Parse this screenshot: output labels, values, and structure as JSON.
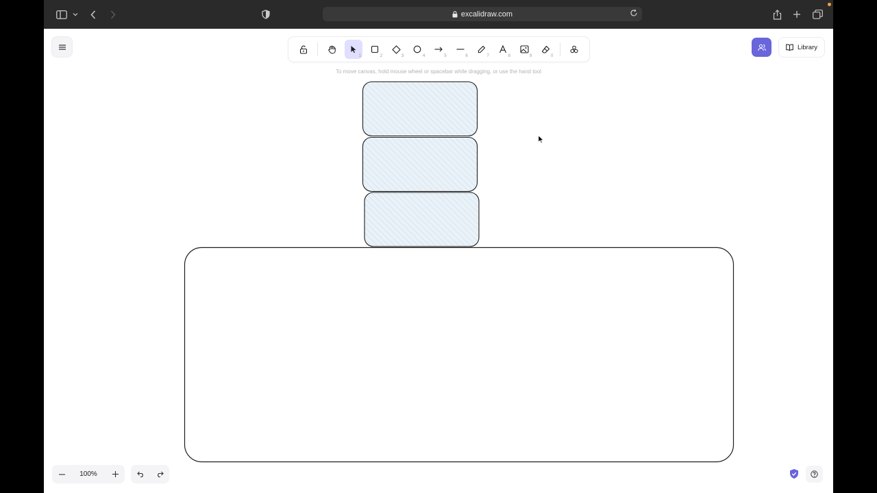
{
  "browser": {
    "url": "excalidraw.com"
  },
  "toolbar": {
    "tools": [
      {
        "name": "lock",
        "key": ""
      },
      {
        "name": "hand",
        "key": ""
      },
      {
        "name": "selection",
        "key": "1"
      },
      {
        "name": "rectangle",
        "key": "2"
      },
      {
        "name": "diamond",
        "key": "3"
      },
      {
        "name": "ellipse",
        "key": "4"
      },
      {
        "name": "arrow",
        "key": "5"
      },
      {
        "name": "line",
        "key": "6"
      },
      {
        "name": "draw",
        "key": "7"
      },
      {
        "name": "text",
        "key": "8"
      },
      {
        "name": "image",
        "key": "9"
      },
      {
        "name": "eraser",
        "key": "0"
      },
      {
        "name": "extra-tools",
        "key": ""
      }
    ],
    "active_tool": "selection"
  },
  "hint": "To move canvas, hold mouse wheel or spacebar while dragging, or use the hand tool",
  "header": {
    "library_label": "Library"
  },
  "footer": {
    "zoom": "100%"
  },
  "colors": {
    "accent": "#6965db",
    "active_tool_bg": "#e0dfff",
    "shape_fill": "#a5d8ff",
    "stroke": "#1e1e1e"
  }
}
